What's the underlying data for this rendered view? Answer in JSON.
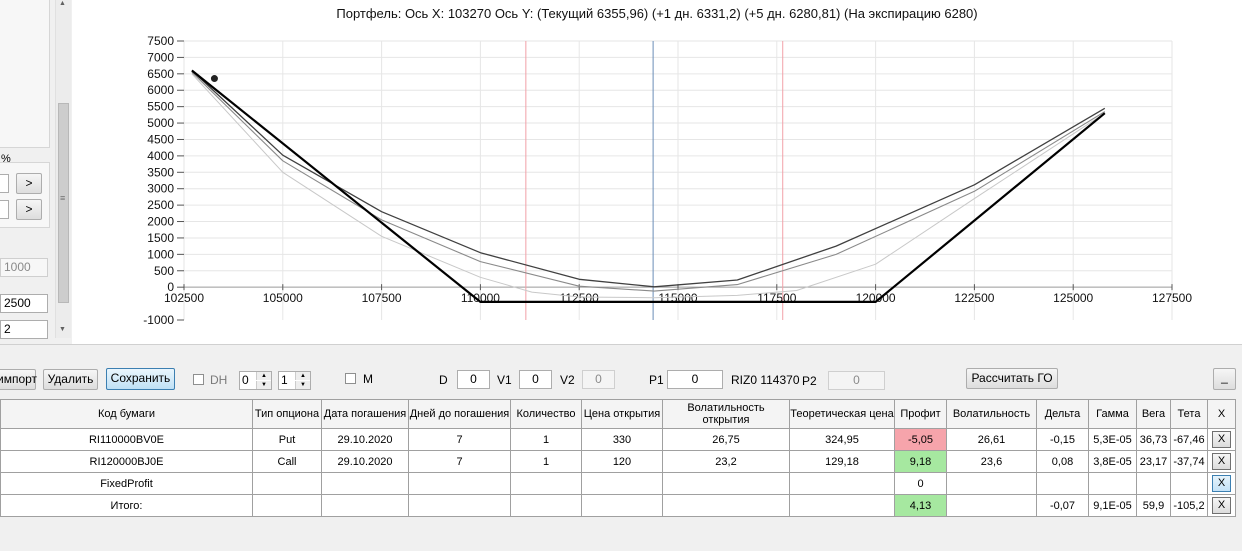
{
  "left_panel": {
    "percent_label": "%",
    "next_btn_1": ">",
    "next_btn_2": ">",
    "disabled_value": "1000",
    "value_2500": "2500",
    "value_2": "2"
  },
  "chart_data": {
    "type": "line",
    "title": "Портфель: Ось X: 103270 Ось Y:  (Текущий 6355,96)  (+1 дн. 6331,2)  (+5 дн. 6280,81)  (На экспирацию 6280)",
    "xlim": [
      102500,
      127500
    ],
    "ylim": [
      -1000,
      7500
    ],
    "x_ticks": [
      "102500",
      "105000",
      "107500",
      "110000",
      "112500",
      "115000",
      "117500",
      "120000",
      "122500",
      "125000",
      "127500"
    ],
    "y_ticks": [
      "7500",
      "7000",
      "6500",
      "6000",
      "5500",
      "5000",
      "4500",
      "4000",
      "3500",
      "3000",
      "2500",
      "2000",
      "1500",
      "1000",
      "500",
      "0",
      "-1000"
    ],
    "y_tick_values": [
      7500,
      7000,
      6500,
      6000,
      5500,
      5000,
      4500,
      4000,
      3500,
      3000,
      2500,
      2000,
      1500,
      1000,
      500,
      0,
      -1000
    ],
    "vlines": [
      {
        "x": 111150,
        "color": "#f2a0a8"
      },
      {
        "x": 114370,
        "color": "#6a8db8"
      },
      {
        "x": 117650,
        "color": "#f2a0a8"
      }
    ],
    "marker": {
      "x": 103270,
      "y": 6355.96
    },
    "series": [
      {
        "color": "#000000",
        "width": 2.2,
        "x": [
          102700,
          110000,
          120000,
          125800
        ],
        "y": [
          6600,
          -450,
          -450,
          5300
        ]
      },
      {
        "color": "#404040",
        "width": 1.3,
        "x": [
          102700,
          105000,
          107500,
          110000,
          112500,
          114400,
          116500,
          119000,
          122500,
          125800
        ],
        "y": [
          6600,
          4020,
          2300,
          1050,
          240,
          10,
          220,
          1250,
          3120,
          5450
        ]
      },
      {
        "color": "#8a8a8a",
        "width": 1.1,
        "x": [
          102700,
          105000,
          107500,
          110000,
          112500,
          114400,
          116500,
          119000,
          122500,
          125800
        ],
        "y": [
          6550,
          3850,
          2050,
          780,
          30,
          -120,
          80,
          1000,
          2920,
          5350
        ]
      },
      {
        "color": "#c8c8c8",
        "width": 1.0,
        "x": [
          102700,
          105000,
          107500,
          110000,
          111300,
          112500,
          114400,
          116500,
          118000,
          120000,
          122500,
          125800
        ],
        "y": [
          6500,
          3500,
          1550,
          300,
          -150,
          -300,
          -320,
          -250,
          -100,
          700,
          2700,
          5300
        ]
      }
    ]
  },
  "toolbar": {
    "import_label": "импорт",
    "delete_label": "Удалить",
    "save_label": "Сохранить",
    "dh_label": "DH",
    "spin1_value": "0",
    "spin2_value": "1",
    "m_label": "M",
    "d_label": "D",
    "d_value": "0",
    "v1_label": "V1",
    "v1_value": "0",
    "v2_label": "V2",
    "v2_value": "0",
    "p1_label": "P1",
    "p1_value": "0",
    "riz_label": "RIZ0 114370",
    "p2_label": "P2",
    "p2_value": "0",
    "calc_label": "Рассчитать ГО",
    "minimize_label": "_"
  },
  "grid": {
    "headers": [
      "Код бумаги",
      "Тип опциона",
      "Дата погашения",
      "Дней до погашения",
      "Количество",
      "Цена открытия",
      "Волатильность открытия",
      "Теоретическая цена",
      "Профит",
      "Волатильность",
      "Дельта",
      "Гамма",
      "Вега",
      "Тета",
      "X"
    ],
    "rows": [
      {
        "code": "RI110000BV0E",
        "type": "Put",
        "date": "29.10.2020",
        "days": "7",
        "qty": "1",
        "price": "330",
        "vol_open": "26,75",
        "theor": "324,95",
        "profit": "-5,05",
        "vol": "26,61",
        "delta": "-0,15",
        "gamma": "5,3E-05",
        "vega": "36,73",
        "theta": "-67,46",
        "x": "X"
      },
      {
        "code": "RI120000BJ0E",
        "type": "Call",
        "date": "29.10.2020",
        "days": "7",
        "qty": "1",
        "price": "120",
        "vol_open": "23,2",
        "theor": "129,18",
        "profit": "9,18",
        "vol": "23,6",
        "delta": "0,08",
        "gamma": "3,8E-05",
        "vega": "23,17",
        "theta": "-37,74",
        "x": "X"
      }
    ],
    "fixed": {
      "code": "FixedProfit",
      "profit": "0",
      "x": "X"
    },
    "total": {
      "code": "Итого:",
      "profit": "4,13",
      "delta": "-0,07",
      "gamma": "9,1E-05",
      "vega": "59,9",
      "theta": "-105,2",
      "x": "X"
    }
  }
}
